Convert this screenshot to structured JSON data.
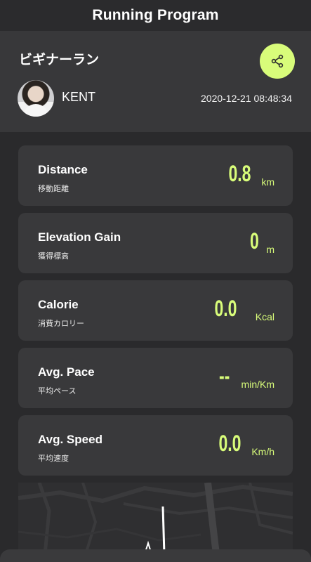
{
  "app": {
    "title": "Running Program"
  },
  "header": {
    "program_name": "ビギナーラン",
    "user_name": "KENT",
    "timestamp": "2020-12-21 08:48:34",
    "share_icon": "share-icon"
  },
  "stats": [
    {
      "title": "Distance",
      "subtitle": "移動距離",
      "value": "0.8",
      "unit": "km"
    },
    {
      "title": "Elevation Gain",
      "subtitle": "獲得標高",
      "value": "0",
      "unit": "m"
    },
    {
      "title": "Calorie",
      "subtitle": "消費カロリー",
      "value": "0.0",
      "unit": "Kcal"
    },
    {
      "title": "Avg. Pace",
      "subtitle": "平均ペース",
      "value": "--",
      "unit": "min/Km"
    },
    {
      "title": "Avg. Speed",
      "subtitle": "平均速度",
      "value": "0.0",
      "unit": "Km/h"
    }
  ],
  "colors": {
    "accent": "#d8fc7a",
    "card": "#39393b",
    "background": "#2a2a2c"
  }
}
